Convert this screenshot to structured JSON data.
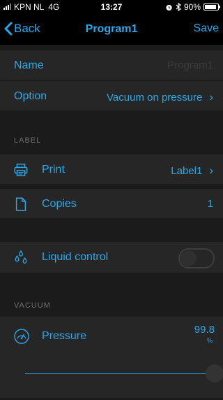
{
  "status": {
    "carrier": "KPN NL",
    "network": "4G",
    "time": "13:27",
    "battery": "90%",
    "battery_level": 0.9
  },
  "nav": {
    "back_label": "Back",
    "title": "Program1",
    "save_label": "Save"
  },
  "rows": {
    "name": {
      "label": "Name",
      "value": "Program1"
    },
    "option": {
      "label": "Option",
      "value": "Vacuum on pressure",
      "chevron": "›"
    }
  },
  "label_section": {
    "title": "LABEL",
    "print": {
      "label": "Print",
      "value": "Label1",
      "chevron": "›",
      "icon": "printer-icon"
    },
    "copies": {
      "label": "Copies",
      "value": "1",
      "icon": "document-icon"
    }
  },
  "liquid": {
    "label": "Liquid control",
    "enabled": false,
    "icon": "drops-icon"
  },
  "vacuum_section": {
    "title": "VACUUM",
    "pressure": {
      "label": "Pressure",
      "value": "99.8",
      "unit": "%",
      "icon": "gauge-icon",
      "slider_level": 1.0
    }
  },
  "colors": {
    "accent": "#2aa9ea",
    "row_bg": "#262626",
    "page_bg": "#1b1b1b",
    "bar_bg": "#000000"
  }
}
